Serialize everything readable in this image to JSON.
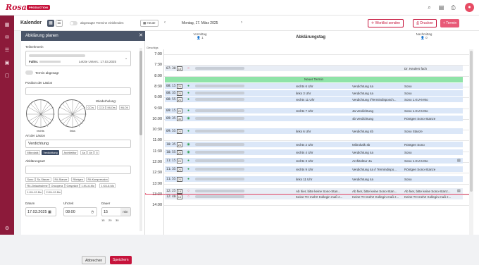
{
  "app": {
    "logo": "Rosa",
    "env_badge": "PRODUCTION"
  },
  "colors": {
    "brand": "#c6133b",
    "nav_bg": "#8c1a3a",
    "appointment": "#dbe7f8",
    "new_appointment": "#8fe3a8",
    "panel_header": "#4a5568"
  },
  "topbar": {
    "icons": [
      "search-icon",
      "clipboard-icon",
      "print-icon",
      "avatar-icon"
    ]
  },
  "nav": {
    "icons": [
      "calendar-icon",
      "mail-icon",
      "tasks-icon",
      "wallet-icon",
      "document-icon",
      "settings-icon"
    ]
  },
  "calendar": {
    "title": "Kalender",
    "toggle_label": "abgesagte Termine einblenden",
    "today_label": "Heute",
    "date_label": "Montag, 17. März 2025",
    "worklist_label": "Worklist senden",
    "print_label": "Drucken",
    "new_label": "Termin",
    "columns": {
      "left": {
        "title": "Vormittag",
        "count": "1"
      },
      "center": {
        "title": "Abklärungstag"
      },
      "right": {
        "title": "Nachmittag",
        "count": "0"
      }
    },
    "closed_label": "Geschlgs",
    "hours": [
      "7:00",
      "7:30",
      "8:00",
      "8:30",
      "9:00",
      "9:30",
      "10:00",
      "10:30",
      "11:00",
      "11:30",
      "12:00",
      "12:30",
      "13:00",
      "13:30",
      "14:00"
    ],
    "new_appointment_label": "Neuer Termin",
    "appointments": [
      {
        "time": "07:30",
        "dur": "15",
        "status": "cancelled",
        "c3": "",
        "c4": "",
        "c5": "Dr. Keulers fach"
      },
      {
        "time": "08:15",
        "dur": "20",
        "status": "done",
        "c3": "rechts 6 Uhr",
        "c4": "Verdichtung 4a",
        "c5": "Sono"
      },
      {
        "time": "08:35",
        "dur": "20",
        "status": "done",
        "c3": "links 3 Uhr",
        "c4": "Verdichtung 4a",
        "c5": "Sono"
      },
      {
        "time": "08:55",
        "dur": "20",
        "status": "done",
        "c3": "rechts 11 Uhr",
        "c4": "Verdichtung //Termindisposch...",
        "c5": "Sono 1.KU-6-Mo"
      },
      {
        "time": "09:15",
        "dur": "20",
        "status": "done",
        "c3": "rechts 7 Uhr",
        "c4": "4a Verdichtung",
        "c5": "Sono 1.KU-6-Mo"
      },
      {
        "time": "09:35",
        "dur": "30",
        "status": "check",
        "c3": "",
        "c4": "4b Verdichtung",
        "c5": "Röntgen Sono-Stanze"
      },
      {
        "time": "09:55",
        "dur": "20",
        "status": "done",
        "c3": "links 6 Uhr",
        "c4": "Verdichtung 4b",
        "c5": "Sono Stanze"
      },
      {
        "time": "10:35",
        "dur": "20",
        "status": "check",
        "c3": "rechts 2 Uhr",
        "c4": "Mikrokalk 4b",
        "c5": "Röntgen Sono"
      },
      {
        "time": "10:55",
        "dur": "20",
        "status": "check",
        "c3": "rechts 4 Uhr",
        "c4": "Verdichtung 4a",
        "c5": "Sono"
      },
      {
        "time": "11:15",
        "dur": "20",
        "status": "done",
        "c3": "rechts 3 Uhr",
        "c4": "Architektur 4a",
        "c5": "Sono 1.KU-6-Mo"
      },
      {
        "time": "11:35",
        "dur": "20",
        "status": "done",
        "c3": "rechts 9 Uhr",
        "c4": "Verdichtung 4a // Termindispo...",
        "c5": "Röntgen Sono-Stanze"
      },
      {
        "time": "11:55",
        "dur": "20",
        "status": "done",
        "c3": "links 11 Uhr",
        "c4": "Verdichtung 4a",
        "c5": "Sono"
      },
      {
        "time": "12:25",
        "dur": "15",
        "status": "cancelled",
        "c3": "Ab hier, bitte keine Sono-Stan...",
        "c4": "Ab hier, bitte keine Sono-Stan...",
        "c5": "Ab hier, bitte keine Sono-Stanz..."
      },
      {
        "time": "12:40",
        "dur": "15",
        "status": "cancelled",
        "c3": "Keine TH mehr! Kollegin muß z...",
        "c4": "Keine TH mehr! Kollegin muß z...",
        "c5": "Keine TH mehr! Kollegin muß z..."
      }
    ]
  },
  "panel": {
    "title": "Abklärung planen",
    "participant_label": "Teilnehmerin",
    "case_prefix": "Fallnr.",
    "last_exam": "Letzte Unters.: 17.03.2025",
    "cancelled_label": "Termin abgesagt",
    "lesion_position_label": "Position der Läsion",
    "repeat_label": "Wiederholung:",
    "repeat_options": [
      "CCrs",
      "CCli",
      "MLOrs",
      "MLOli"
    ],
    "breast_right": "rechts",
    "breast_left": "links",
    "lesion_type_label": "Art der Läsion",
    "lesion_type_value": "Verdichtung",
    "lesion_chips": [
      "Mikrokalk",
      "Verdichtung",
      "Architektur",
      "4a",
      "4b",
      "5"
    ],
    "procedure_label": "Abklärungsart",
    "procedure_chips": [
      "Sono",
      "So-Stanze",
      "Rö-Stanze",
      "Röntgen",
      "Rö-Kompression",
      "Rö-Zielaufnahme",
      "Oncopera",
      "Gespräch",
      "1.KU-6-Mo",
      "1.KU-6-Mo",
      "1.KU-12-Mo",
      "2.KU-12-Mo"
    ],
    "date_label": "Datum",
    "date_value": "17.03.2025",
    "time_label": "Uhrzeit",
    "time_value": "08:00",
    "duration_label": "Dauer",
    "duration_value": "15",
    "duration_unit": "min",
    "duration_options": [
      "15",
      "20",
      "30"
    ],
    "cancel_label": "Abbrechen",
    "save_label": "Speichern"
  }
}
